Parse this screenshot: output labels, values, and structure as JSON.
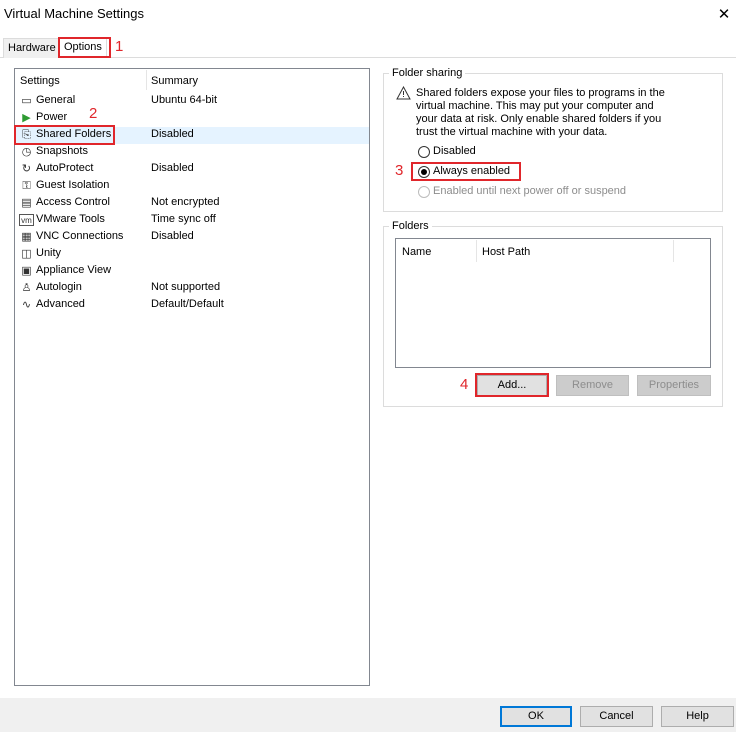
{
  "window": {
    "title": "Virtual Machine Settings",
    "close_glyph": "✕"
  },
  "tabs": [
    {
      "label": "Hardware",
      "active": false
    },
    {
      "label": "Options",
      "active": true
    }
  ],
  "annotations": {
    "n1": "1",
    "n2": "2",
    "n3": "3",
    "n4": "4",
    "color": "#e0262b"
  },
  "settings_list": {
    "header_settings": "Settings",
    "header_summary": "Summary",
    "items": [
      {
        "icon": "monitor-icon",
        "glyph": "▭",
        "label": "General",
        "summary": "Ubuntu 64-bit"
      },
      {
        "icon": "play-icon",
        "glyph": "▶",
        "label": "Power",
        "summary": ""
      },
      {
        "icon": "shared-folder-icon",
        "glyph": "⎘",
        "label": "Shared Folders",
        "summary": "Disabled",
        "selected": true
      },
      {
        "icon": "snapshot-icon",
        "glyph": "◷",
        "label": "Snapshots",
        "summary": ""
      },
      {
        "icon": "autoprotect-icon",
        "glyph": "↻",
        "label": "AutoProtect",
        "summary": "Disabled"
      },
      {
        "icon": "guest-isolation-icon",
        "glyph": "⚿",
        "label": "Guest Isolation",
        "summary": ""
      },
      {
        "icon": "access-control-icon",
        "glyph": "▤",
        "label": "Access Control",
        "summary": "Not encrypted"
      },
      {
        "icon": "vmware-tools-icon",
        "glyph": "vm",
        "label": "VMware Tools",
        "summary": "Time sync off"
      },
      {
        "icon": "vnc-icon",
        "glyph": "▦",
        "label": "VNC Connections",
        "summary": "Disabled"
      },
      {
        "icon": "unity-icon",
        "glyph": "◫",
        "label": "Unity",
        "summary": ""
      },
      {
        "icon": "appliance-icon",
        "glyph": "▣",
        "label": "Appliance View",
        "summary": ""
      },
      {
        "icon": "autologin-icon",
        "glyph": "♙",
        "label": "Autologin",
        "summary": "Not supported"
      },
      {
        "icon": "advanced-icon",
        "glyph": "∿",
        "label": "Advanced",
        "summary": "Default/Default"
      }
    ]
  },
  "folder_sharing": {
    "title": "Folder sharing",
    "warning_lines": [
      "Shared folders expose your files to programs in the",
      "virtual machine. This may put your computer and",
      "your data at risk. Only enable shared folders if you",
      "trust the virtual machine with your data."
    ],
    "options": [
      {
        "label": "Disabled",
        "checked": false,
        "enabled": true
      },
      {
        "label": "Always enabled",
        "checked": true,
        "enabled": true
      },
      {
        "label": "Enabled until next power off or suspend",
        "checked": false,
        "enabled": false
      }
    ]
  },
  "folders": {
    "title": "Folders",
    "col_name": "Name",
    "col_host_path": "Host Path",
    "add_label": "Add...",
    "remove_label": "Remove",
    "properties_label": "Properties"
  },
  "footer": {
    "ok_label": "OK",
    "cancel_label": "Cancel",
    "help_label": "Help"
  }
}
